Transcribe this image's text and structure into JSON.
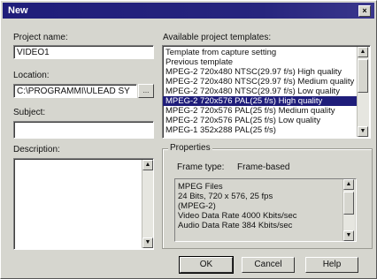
{
  "window": {
    "title": "New",
    "close_glyph": "×"
  },
  "left": {
    "project_name_label": "Project name:",
    "project_name_value": "VIDEO1",
    "location_label": "Location:",
    "location_value": "C:\\PROGRAMMI\\ULEAD SY",
    "browse_label": "...",
    "subject_label": "Subject:",
    "subject_value": "",
    "description_label": "Description:",
    "description_value": ""
  },
  "templates": {
    "label": "Available project templates:",
    "items": [
      {
        "label": "Template from capture setting",
        "selected": false
      },
      {
        "label": "Previous template",
        "selected": false
      },
      {
        "label": "MPEG-2 720x480 NTSC(29.97 f/s) High quality",
        "selected": false
      },
      {
        "label": "MPEG-2 720x480 NTSC(29.97 f/s) Medium quality",
        "selected": false
      },
      {
        "label": "MPEG-2 720x480 NTSC(29.97 f/s) Low quality",
        "selected": false
      },
      {
        "label": "MPEG-2 720x576 PAL(25 f/s)   High quality",
        "selected": true
      },
      {
        "label": "MPEG-2 720x576 PAL(25 f/s)   Medium quality",
        "selected": false
      },
      {
        "label": "MPEG-2 720x576 PAL(25 f/s)   Low quality",
        "selected": false
      },
      {
        "label": "MPEG-1 352x288 PAL(25 f/s)",
        "selected": false
      }
    ]
  },
  "properties": {
    "title": "Properties",
    "frame_type_label": "Frame type:",
    "frame_type_value": "Frame-based",
    "details": [
      "MPEG Files",
      "24 Bits, 720 x 576, 25 fps",
      "(MPEG-2)",
      "Video Data Rate 4000 Kbits/sec",
      "Audio Data Rate 384 Kbits/sec"
    ]
  },
  "buttons": {
    "ok": "OK",
    "cancel": "Cancel",
    "help": "Help"
  },
  "icons": {
    "scroll_up": "▲",
    "scroll_down": "▼"
  },
  "colors": {
    "title_bar": "#1f1d7a",
    "selection": "#1f1d7a",
    "face": "#d6d6cf"
  }
}
